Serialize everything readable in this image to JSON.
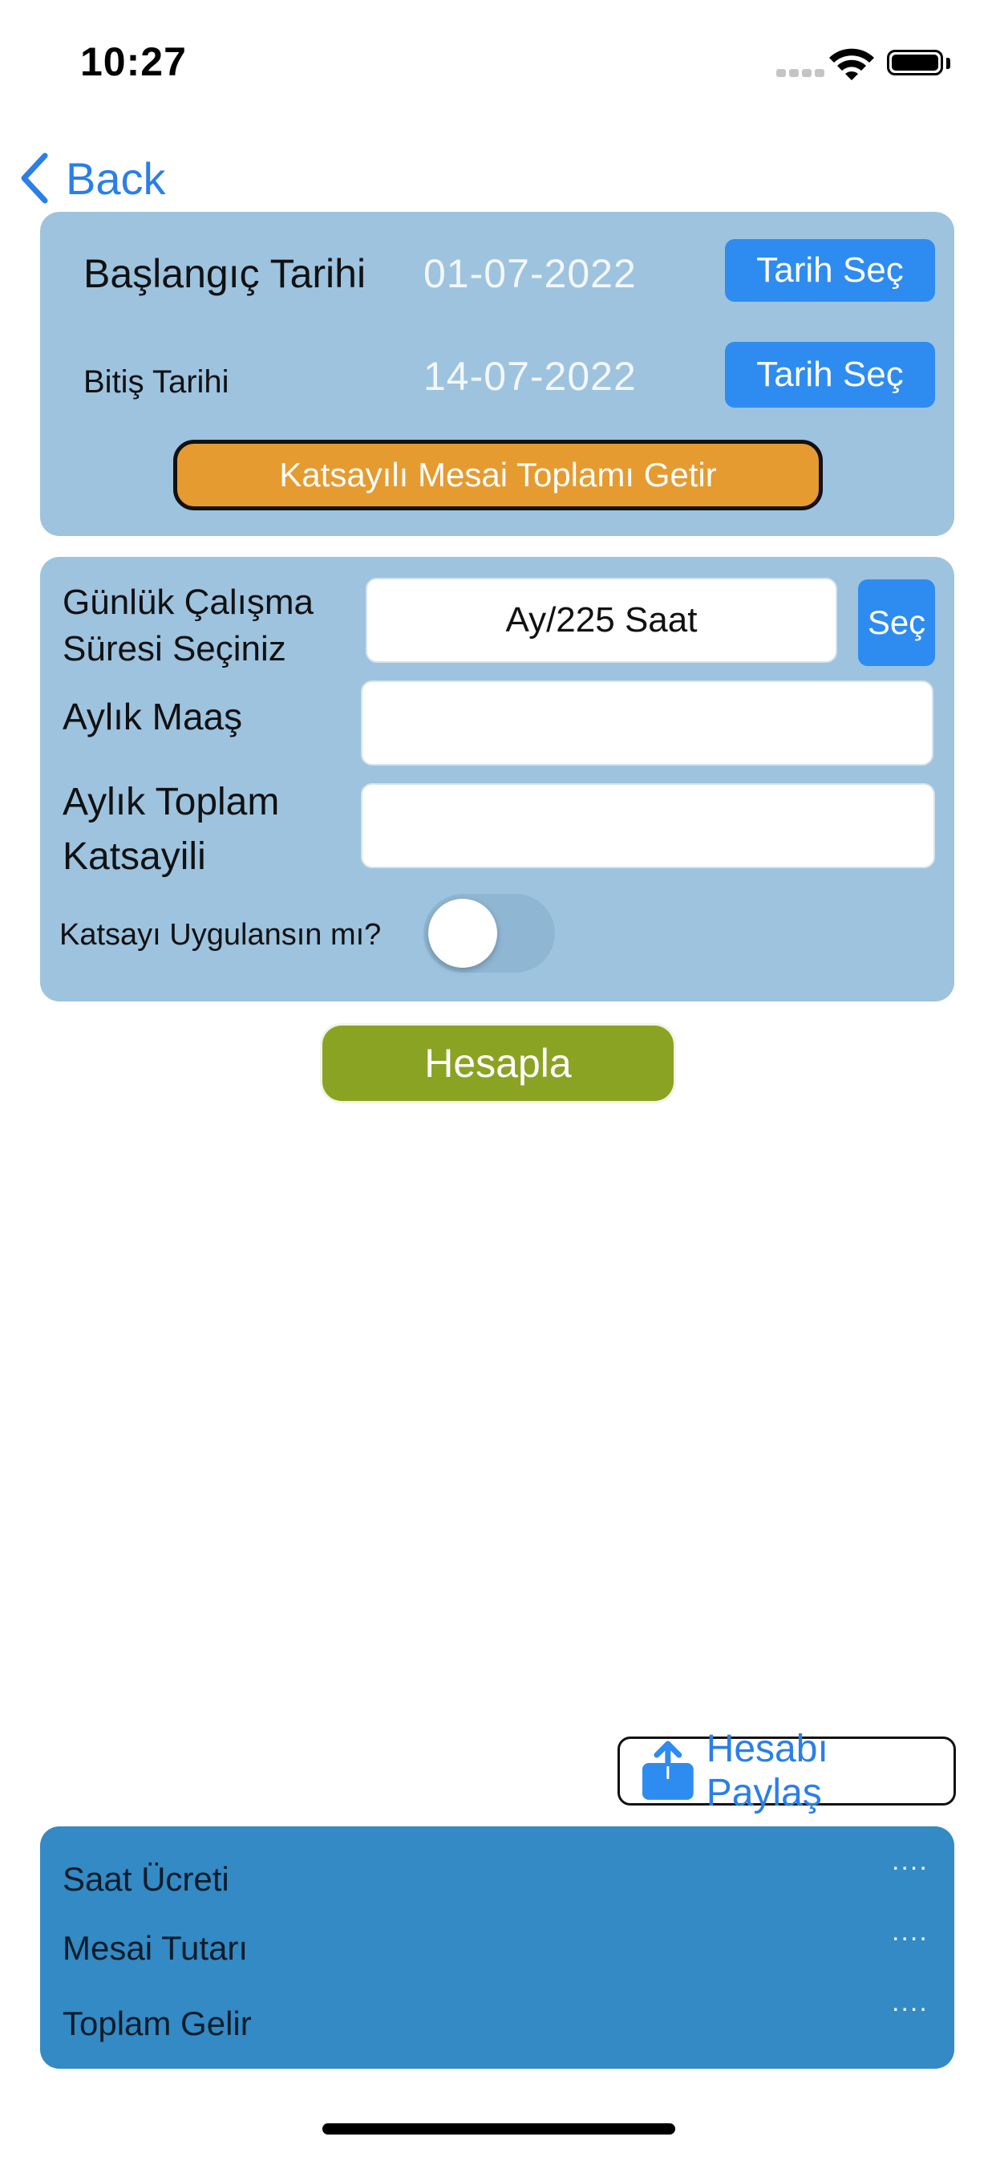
{
  "status_bar": {
    "time": "10:27"
  },
  "nav": {
    "back_label": "Back"
  },
  "dates": {
    "start_label": "Başlangıç Tarihi",
    "start_value": "01-07-2022",
    "end_label": "Bitiş Tarihi",
    "end_value": "14-07-2022",
    "pick_button_label": "Tarih Seç",
    "fetch_button_label": "Katsayılı Mesai Toplamı Getir"
  },
  "form": {
    "work_duration_label_line1": "Günlük Çalışma",
    "work_duration_label_line2": "Süresi Seçiniz",
    "work_duration_value": "Ay/225 Saat",
    "select_button_label": "Seç",
    "salary_label": "Aylık Maaş",
    "salary_value": "",
    "total_coef_label_line1": "Aylık Toplam",
    "total_coef_label_line2": "Katsayili",
    "total_coef_value": "",
    "apply_coef_label": "Katsayı Uygulansın mı?",
    "apply_coef_on": false
  },
  "calculate_label": "Hesapla",
  "share": {
    "label": "Hesabı Paylaş",
    "icon": "share-icon"
  },
  "results": {
    "items": [
      {
        "label": "Saat Ücreti",
        "value": "...."
      },
      {
        "label": "Mesai Tutarı",
        "value": "...."
      },
      {
        "label": "Toplam Gelir",
        "value": "...."
      }
    ]
  },
  "colors": {
    "panel": "#9dc3df",
    "accent_blue": "#2e8cf0",
    "fetch_orange": "#e59b30",
    "calc_green": "#8ba323",
    "results_blue": "#338ac4"
  }
}
